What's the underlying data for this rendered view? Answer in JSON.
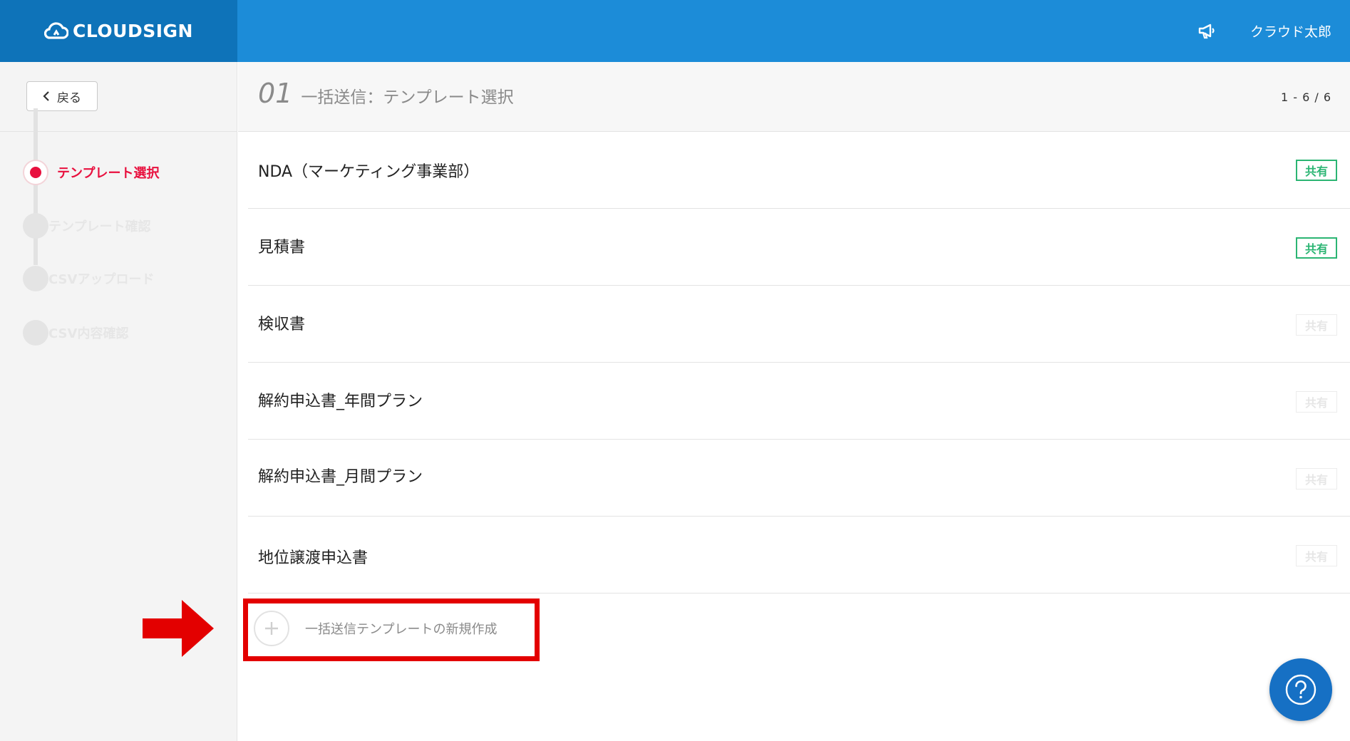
{
  "header": {
    "logo_text": "CLOUDSIGN",
    "user_name": "クラウド太郎",
    "brand_color": "#1c8cd8",
    "logo_bg_color": "#0e73b9"
  },
  "sidebar": {
    "back_label": "戻る",
    "steps": [
      {
        "label": "テンプレート選択",
        "state": "active"
      },
      {
        "label": "テンプレート確認",
        "state": "inactive"
      },
      {
        "label": "CSVアップロード",
        "state": "inactive"
      },
      {
        "label": "CSV内容確認",
        "state": "inactive"
      }
    ],
    "active_color": "#e8103e"
  },
  "title": {
    "number": "01",
    "text": "一括送信：テンプレート選択",
    "page_count": "1 - 6 / 6"
  },
  "templates": [
    {
      "name": "NDA（マーケティング事業部）",
      "badge": "共有",
      "shared": true
    },
    {
      "name": "見積書",
      "badge": "共有",
      "shared": true
    },
    {
      "name": "検収書",
      "badge": "共有",
      "shared": false
    },
    {
      "name": "解約申込書_年間プラン",
      "badge": "共有",
      "shared": false
    },
    {
      "name": "解約申込書_月間プラン",
      "badge": "共有",
      "shared": false
    },
    {
      "name": "地位譲渡申込書",
      "badge": "共有",
      "shared": false
    }
  ],
  "new_template": {
    "label": "一括送信テンプレートの新規作成",
    "icon": "plus-icon"
  },
  "highlight_color": "#e30000",
  "help": {
    "icon": "question-icon"
  }
}
